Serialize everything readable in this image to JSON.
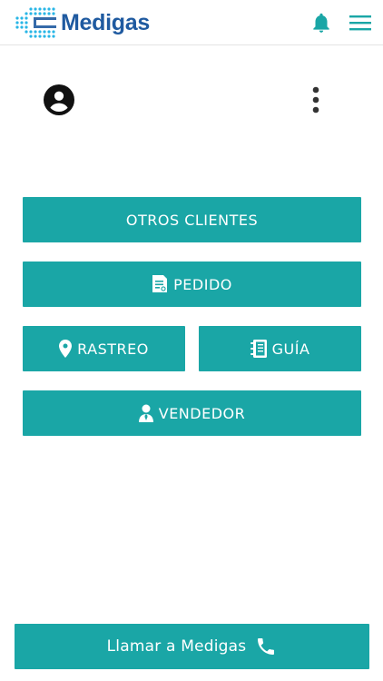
{
  "header": {
    "logo_text": "Medigas"
  },
  "icons": {
    "logo": "cross-dots-logo",
    "bell": "bell-icon",
    "menu": "hamburger-menu-icon",
    "avatar": "account-circle-icon",
    "kebab": "more-vert-icon",
    "pedido": "document-icon",
    "rastreo": "map-pin-icon",
    "guia": "notebook-icon",
    "vendedor": "person-icon",
    "call": "phone-icon"
  },
  "colors": {
    "brand_blue": "#1f5aa0",
    "teal": "#1aa6a6",
    "logo_cyan": "#29b6e6"
  },
  "buttons": {
    "otros_clientes": "OTROS CLIENTES",
    "pedido": "PEDIDO",
    "rastreo": "RASTREO",
    "guia": "GUÍA",
    "vendedor": "VENDEDOR"
  },
  "footer": {
    "call_label": "Llamar a Medigas"
  }
}
